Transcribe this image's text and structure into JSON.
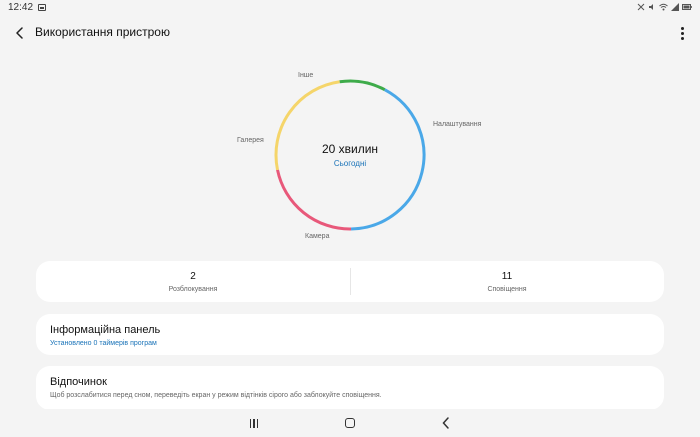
{
  "status_bar": {
    "time": "12:42",
    "image_icon": "image-icon",
    "right_icons": [
      "mute-icon",
      "no-sound-icon",
      "wifi-icon",
      "signal-icon",
      "battery-icon"
    ]
  },
  "app_bar": {
    "title": "Використання пристрою",
    "back_icon": "arrow-left-icon",
    "more_icon": "more-vertical-icon"
  },
  "usage": {
    "total": "20 хвилин",
    "period": "Сьогодні",
    "segments": [
      {
        "label": "Налаштування",
        "color": "#4aa8e8",
        "fraction": 0.42
      },
      {
        "label": "Камера",
        "color": "#e8587a",
        "fraction": 0.22
      },
      {
        "label": "Галерея",
        "color": "#f5d56a",
        "fraction": 0.26
      },
      {
        "label": "Інше",
        "color": "#3eab4a",
        "fraction": 0.1
      }
    ]
  },
  "stats": [
    {
      "value": "2",
      "label": "Розблокування"
    },
    {
      "value": "11",
      "label": "Сповіщення"
    }
  ],
  "dashboard": {
    "title": "Інформаційна панель",
    "subtitle": "Установлено 0 таймерів програм"
  },
  "rest": {
    "title": "Відпочинок",
    "subtitle": "Щоб розслабитися перед сном, переведіть екран у режим відтінків сірого або заблокуйте сповіщення."
  },
  "nav": {
    "recents_icon": "recents-icon",
    "home_icon": "home-icon",
    "back_icon": "back-icon"
  },
  "colors": {
    "accent": "#1a73b8",
    "background": "#f4f4f4",
    "card": "#ffffff"
  }
}
